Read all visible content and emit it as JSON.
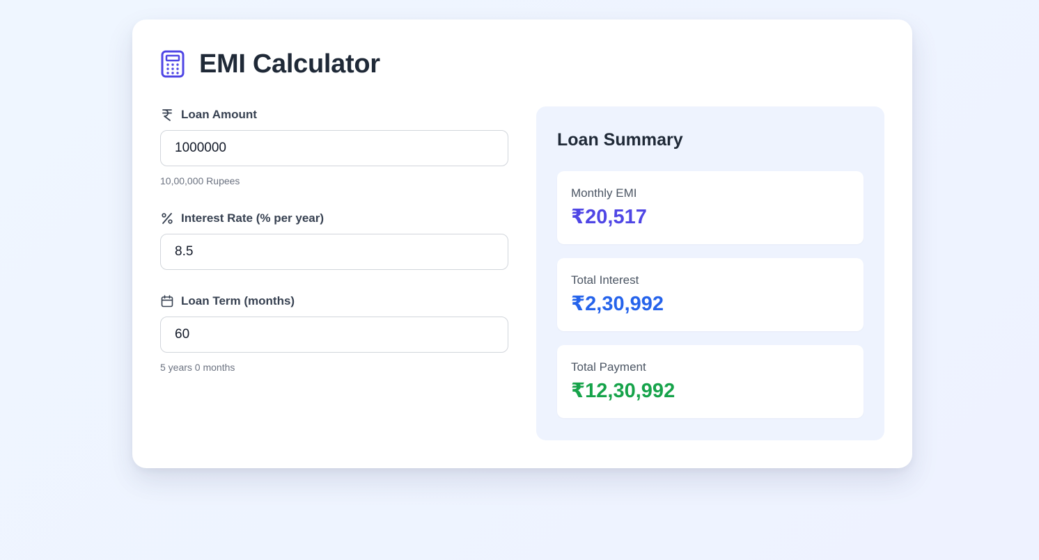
{
  "header": {
    "title": "EMI Calculator",
    "icon": "calculator-icon",
    "accent": "#4f46e5"
  },
  "fields": [
    {
      "icon": "rupee-icon",
      "label": "Loan Amount",
      "value": "1000000",
      "hint": "10,00,000 Rupees"
    },
    {
      "icon": "percent-icon",
      "label": "Interest Rate (% per year)",
      "value": "8.5",
      "hint": ""
    },
    {
      "icon": "calendar-icon",
      "label": "Loan Term (months)",
      "value": "60",
      "hint": "5 years 0 months"
    }
  ],
  "summary": {
    "title": "Loan Summary",
    "items": [
      {
        "label": "Monthly EMI",
        "value": "₹20,517",
        "color": "#4f46e5"
      },
      {
        "label": "Total Interest",
        "value": "₹2,30,992",
        "color": "#2563eb"
      },
      {
        "label": "Total Payment",
        "value": "₹12,30,992",
        "color": "#16a34a"
      }
    ]
  }
}
